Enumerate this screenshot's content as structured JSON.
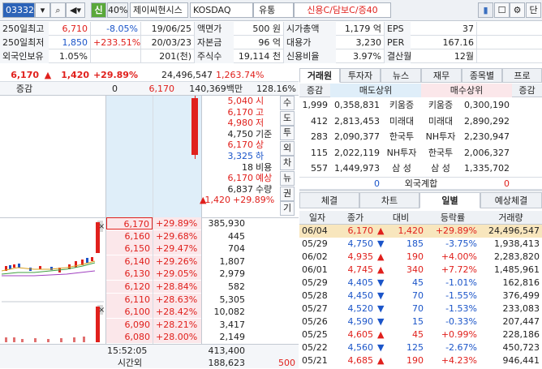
{
  "toolbar": {
    "code": "033320",
    "credit": "신",
    "margin": "40%",
    "name": "제이씨현시스",
    "market": "KOSDAQ",
    "sector": "유통",
    "status": "신용C/담보C/증40"
  },
  "info": {
    "rows": [
      [
        {
          "l": "250일최고",
          "v": "6,710",
          "c": "red"
        },
        {
          "v": "-8.05%",
          "c": "blue"
        },
        {
          "v": "19/06/25"
        },
        {
          "l": "액면가",
          "v": "500 원"
        },
        {
          "l": "시가총액",
          "v": "1,179 억"
        },
        {
          "l": "EPS",
          "v": "37"
        }
      ],
      [
        {
          "l": "250일최저",
          "v": "1,850",
          "c": "blue"
        },
        {
          "v": "+233.51%",
          "c": "red"
        },
        {
          "v": "20/03/23"
        },
        {
          "l": "자본금",
          "v": "96 억"
        },
        {
          "l": "대용가",
          "v": "3,230"
        },
        {
          "l": "PER",
          "v": "167.16"
        }
      ],
      [
        {
          "l": "외국인보유",
          "v": "1.05%"
        },
        {
          "v": ""
        },
        {
          "v": "201(천)"
        },
        {
          "l": "주식수",
          "v": "19,114 천"
        },
        {
          "l": "신용비율",
          "v": "3.97%"
        },
        {
          "l": "결산월",
          "v": "12월"
        }
      ]
    ]
  },
  "price": {
    "current": "6,170",
    "change": "1,420",
    "rate": "+29.89%",
    "volume": "24,496,547",
    "vol_rate": "1,263.74%",
    "row2_label": "증감",
    "row2_a": "0",
    "row2_b": "6,170",
    "row2_c": "140,369백만",
    "row2_d": "128.16%"
  },
  "summary": [
    {
      "v": "5,040",
      "k": "시",
      "c": "red"
    },
    {
      "v": "6,170",
      "k": "고",
      "c": "red"
    },
    {
      "v": "4,980",
      "k": "저",
      "c": "red"
    },
    {
      "v": "4,750",
      "k": "기준",
      "c": ""
    },
    {
      "v": "6,170",
      "k": "상",
      "c": "red"
    },
    {
      "v": "3,325",
      "k": "하",
      "c": "blue"
    },
    {
      "v": "18",
      "k": "비용",
      "c": ""
    },
    {
      "v": "6,170",
      "k": "예상",
      "c": "red"
    },
    {
      "v": "6,837",
      "k": "수량",
      "c": ""
    },
    {
      "v": "1,420",
      "k": "+29.89%",
      "c": "red"
    }
  ],
  "vertical_tabs": [
    "수",
    "도",
    "투",
    "외",
    "차",
    "뉴",
    "권",
    "기"
  ],
  "bids": [
    {
      "p": "6,170",
      "r": "+29.89%",
      "q": "385,930"
    },
    {
      "p": "6,160",
      "r": "+29.68%",
      "q": "445"
    },
    {
      "p": "6,150",
      "r": "+29.47%",
      "q": "704"
    },
    {
      "p": "6,140",
      "r": "+29.26%",
      "q": "1,807"
    },
    {
      "p": "6,130",
      "r": "+29.05%",
      "q": "2,979"
    },
    {
      "p": "6,120",
      "r": "+28.84%",
      "q": "582"
    },
    {
      "p": "6,110",
      "r": "+28.63%",
      "q": "5,305"
    },
    {
      "p": "6,100",
      "r": "+28.42%",
      "q": "10,082"
    },
    {
      "p": "6,090",
      "r": "+28.21%",
      "q": "3,417"
    },
    {
      "p": "6,080",
      "r": "+28.00%",
      "q": "2,149"
    }
  ],
  "bottom": {
    "time": "15:52:05",
    "total": "413,400",
    "after_label": "시간외",
    "after_qty": "188,623",
    "after_extra": "500"
  },
  "top_tabs": [
    "거래원",
    "투자자",
    "뉴스",
    "재무",
    "종목별",
    "프로"
  ],
  "broker": {
    "headers": [
      "증감",
      "매도상위",
      "매수상위",
      "증감"
    ],
    "rows": [
      {
        "a": "1,999",
        "b": "0,358,831",
        "c": "키움증",
        "d": "키움증",
        "e": "0,300,190"
      },
      {
        "a": "412",
        "b": "2,813,453",
        "c": "미래대",
        "d": "미래대",
        "e": "2,890,292"
      },
      {
        "a": "283",
        "b": "2,090,377",
        "c": "한국투",
        "d": "NH투자",
        "e": "2,230,947"
      },
      {
        "a": "115",
        "b": "2,022,119",
        "c": "NH투자",
        "d": "한국투",
        "e": "2,006,327"
      },
      {
        "a": "557",
        "b": "1,449,973",
        "c": "삼 성",
        "d": "삼 성",
        "e": "1,335,702"
      }
    ],
    "foreign_left": "0",
    "foreign_label": "외국계합",
    "foreign_right": "0"
  },
  "bottom_tabs": [
    "체결",
    "차트",
    "일별",
    "예상체결"
  ],
  "daily": {
    "headers": [
      "일자",
      "종가",
      "대비",
      "등락률",
      "거래량"
    ],
    "rows": [
      {
        "d": "06/04",
        "p": "6,170",
        "dir": "up",
        "c": "1,420",
        "r": "+29.89%",
        "v": "24,496,547",
        "hl": true
      },
      {
        "d": "05/29",
        "p": "4,750",
        "dir": "down",
        "c": "185",
        "r": "-3.75%",
        "v": "1,938,413"
      },
      {
        "d": "06/02",
        "p": "4,935",
        "dir": "up",
        "c": "190",
        "r": "+4.00%",
        "v": "2,283,820"
      },
      {
        "d": "06/01",
        "p": "4,745",
        "dir": "up",
        "c": "340",
        "r": "+7.72%",
        "v": "1,485,961"
      },
      {
        "d": "05/29",
        "p": "4,405",
        "dir": "down",
        "c": "45",
        "r": "-1.01%",
        "v": "162,816"
      },
      {
        "d": "05/28",
        "p": "4,450",
        "dir": "down",
        "c": "70",
        "r": "-1.55%",
        "v": "376,499"
      },
      {
        "d": "05/27",
        "p": "4,520",
        "dir": "down",
        "c": "70",
        "r": "-1.53%",
        "v": "233,083"
      },
      {
        "d": "05/26",
        "p": "4,590",
        "dir": "down",
        "c": "15",
        "r": "-0.33%",
        "v": "207,447"
      },
      {
        "d": "05/25",
        "p": "4,605",
        "dir": "up",
        "c": "45",
        "r": "+0.99%",
        "v": "228,186"
      },
      {
        "d": "05/22",
        "p": "4,560",
        "dir": "down",
        "c": "125",
        "r": "-2.67%",
        "v": "450,723"
      },
      {
        "d": "05/21",
        "p": "4,685",
        "dir": "up",
        "c": "190",
        "r": "+4.23%",
        "v": "946,441"
      }
    ]
  },
  "colors": {
    "up": "#e0201c",
    "down": "#1b55c9",
    "ask_bg": "#dfeef9",
    "bid_bg": "#fbe7ea"
  }
}
